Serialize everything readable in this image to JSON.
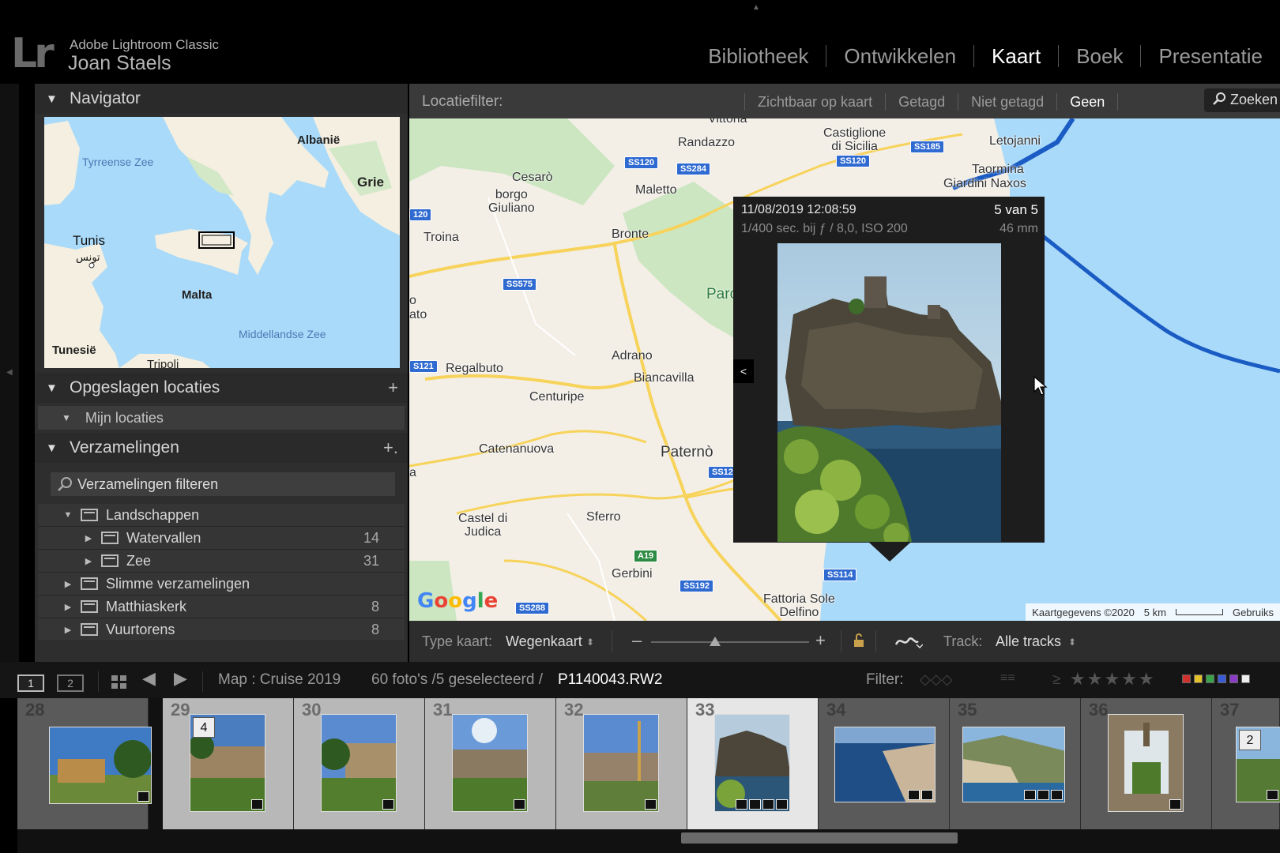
{
  "identity": {
    "app_name": "Adobe Lightroom Classic",
    "user_name": "Joan Staels",
    "logo": "Lr"
  },
  "modules": [
    {
      "label": "Bibliotheek",
      "active": false
    },
    {
      "label": "Ontwikkelen",
      "active": false
    },
    {
      "label": "Kaart",
      "active": true
    },
    {
      "label": "Boek",
      "active": false
    },
    {
      "label": "Presentatie",
      "active": false
    }
  ],
  "left_panel": {
    "navigator": {
      "title": "Navigator",
      "map_labels": {
        "albania": "Albanië",
        "tyrrhenian": "Tyrreense Zee",
        "greece": "Grie",
        "tunis": "Tunis",
        "tunis_ar": "تونس",
        "malta": "Malta",
        "med": "Middellandse Zee",
        "tunisia": "Tunesië",
        "tripoli": "Tripoli"
      }
    },
    "saved_locations": {
      "title": "Opgeslagen locaties",
      "add": "+",
      "folder": "Mijn locaties"
    },
    "collections": {
      "title": "Verzamelingen",
      "add": "+.",
      "filter_label": "Verzamelingen filteren",
      "items": [
        {
          "label": "Landschappen",
          "count": "",
          "expanded": true,
          "indent": 0
        },
        {
          "label": "Watervallen",
          "count": "14",
          "expanded": false,
          "indent": 1
        },
        {
          "label": "Zee",
          "count": "31",
          "expanded": false,
          "indent": 1
        },
        {
          "label": "Slimme verzamelingen",
          "count": "",
          "expanded": false,
          "indent": 0
        },
        {
          "label": "Matthiaskerk",
          "count": "8",
          "expanded": false,
          "indent": 0
        },
        {
          "label": "Vuurtorens",
          "count": "8",
          "expanded": false,
          "indent": 0
        }
      ]
    }
  },
  "location_filter": {
    "label": "Locatiefilter:",
    "options": [
      {
        "label": "Zichtbaar op kaart",
        "active": false
      },
      {
        "label": "Getagd",
        "active": false
      },
      {
        "label": "Niet getagd",
        "active": false
      },
      {
        "label": "Geen",
        "active": true
      }
    ],
    "search_label": "Zoeken"
  },
  "map": {
    "towns": {
      "vittoria": "Vittoria",
      "castiglione": "Castiglione\ndi Sicilia",
      "randazzo": "Randazzo",
      "letojanni": "Letojanni",
      "taormina": "Taormina",
      "giardini": "Giardini Naxos",
      "cesaro": "Cesarò",
      "maletto": "Maletto",
      "borgo": "borgo\nGiuliano",
      "troina": "Troina",
      "bronte": "Bronte",
      "parco": "Parc",
      "o": "o",
      "ato": "ato",
      "adrano": "Adrano",
      "regalbuto": "Regalbuto",
      "biancavilla": "Biancavilla",
      "centuripe": "Centuripe",
      "catenanuova": "Catenanuova",
      "paterno": "Paternò",
      "a": "a",
      "castel": "Castel di\nJudica",
      "sferro": "Sferro",
      "gerbini": "Gerbini",
      "fattoria": "Fattoria Sole\nDelfino"
    },
    "roads": {
      "ss185": "SS185",
      "ss120a": "SS120",
      "ss284": "SS284",
      "ss120b": "SS120",
      "ss120c": "120",
      "ss575": "SS575",
      "ss121": "S121",
      "ss12": "SS12",
      "a19": "A19",
      "ss192": "SS192",
      "ss114": "SS114",
      "ss288": "SS288"
    },
    "google": [
      "G",
      "o",
      "o",
      "g",
      "l",
      "e"
    ],
    "footer": {
      "attribution": "Kaartgegevens ©2020",
      "scale": "5 km",
      "terms": "Gebruiks"
    }
  },
  "popup": {
    "datetime": "11/08/2019 12:08:59",
    "position": "5 van 5",
    "exif": "1/400 sec. bij ƒ / 8,0, ISO 200",
    "focal": "46 mm",
    "prev_icon": "<"
  },
  "map_toolbar": {
    "type_label": "Type kaart:",
    "type_value": "Wegenkaart",
    "zoom_minus": "–",
    "zoom_plus": "+",
    "track_label": "Track:",
    "track_value": "Alle tracks"
  },
  "filmstrip_bar": {
    "view1": "1",
    "view2": "2",
    "source": "Map : Cruise 2019",
    "count": "60 foto's /5 geselecteerd /",
    "filename": "P1140043.RW2",
    "filter_label": "Filter:",
    "stars": "★★★★★",
    "gte": "≥"
  },
  "filmstrip": [
    {
      "num": "28",
      "state": "normal",
      "stack": ""
    },
    {
      "num": "29",
      "state": "sel",
      "stack": "4"
    },
    {
      "num": "30",
      "state": "sel",
      "stack": ""
    },
    {
      "num": "31",
      "state": "sel",
      "stack": ""
    },
    {
      "num": "32",
      "state": "sel",
      "stack": ""
    },
    {
      "num": "33",
      "state": "cur",
      "stack": ""
    },
    {
      "num": "34",
      "state": "normal",
      "stack": ""
    },
    {
      "num": "35",
      "state": "normal",
      "stack": ""
    },
    {
      "num": "36",
      "state": "normal",
      "stack": ""
    },
    {
      "num": "37",
      "state": "normal",
      "stack": "2"
    }
  ],
  "colors": {
    "accent_track": "#1a5cc4",
    "map_water": "#aadaf9",
    "map_land": "#f3efe7",
    "map_park": "#cbe6c1",
    "road_yellow": "#f7d35b",
    "label_red": "#d0312d",
    "label_yellow": "#e2c12b",
    "label_green": "#3aa34a",
    "label_blue": "#3b5bd6",
    "label_purple": "#8b3cc7",
    "label_white": "#eeeeee"
  }
}
